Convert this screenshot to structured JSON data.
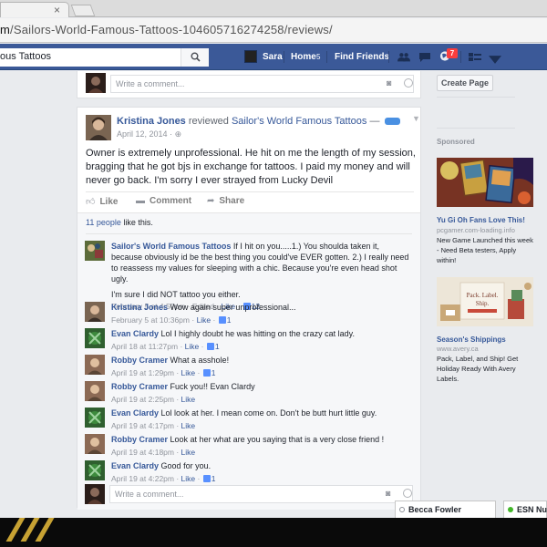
{
  "browser": {
    "url_host": "m",
    "url_path": "/Sailors-World-Famous-Tattoos-104605716274258/reviews/"
  },
  "topbar": {
    "search_value": "ous Tattoos",
    "user_name": "Sara",
    "home_label": "Home",
    "home_count": "5",
    "find_friends_label": "Find Friends",
    "notification_count": "7",
    "brand_color": "#3b5998"
  },
  "top_composer": {
    "placeholder": "Write a comment..."
  },
  "post": {
    "author": "Kristina Jones",
    "verb": "reviewed",
    "page_name": "Sailor's World Famous Tattoos",
    "dash": "—",
    "date": "April 12, 2014 ·",
    "body": "Owner is extremely unprofessional. He hit on me the length of my session, bragging that he got bjs in exchange for tattoos. I paid my money and will never go back. I'm sorry I ever strayed from Lucky Devil",
    "actions": {
      "like": "Like",
      "comment": "Comment",
      "share": "Share"
    },
    "likes_count": "11 people",
    "likes_suffix": "like this."
  },
  "comments": [
    {
      "author": "Sailor's World Famous Tattoos",
      "text": "If I hit on you.....1.) You shoulda taken it, because obviously id be the best thing you could've EVER gotten. 2.) I really need to reassess my values for sleeping with a chic. Because you're even head shot ugly.",
      "text2": "I'm sure I did NOT tattoo you either.",
      "date": "February 5 at 4:57pm",
      "edited": "Edited",
      "like": "Like",
      "likes": "12"
    },
    {
      "author": "Kristina Jones",
      "text": "Wow again super unprofessional...",
      "date": "February 5 at 10:36pm",
      "like": "Like",
      "likes": "1"
    },
    {
      "author": "Evan Clardy",
      "text": "Lol I highly doubt he was hitting on the crazy cat lady.",
      "date": "April 18 at 11:27pm",
      "like": "Like",
      "likes": "1"
    },
    {
      "author": "Robby Cramer",
      "text": "What a asshole!",
      "date": "April 19 at 1:29pm",
      "like": "Like",
      "likes": "1"
    },
    {
      "author": "Robby Cramer",
      "text": "Fuck you!! Evan Clardy",
      "date": "April 19 at 2:25pm",
      "like": "Like",
      "likes": ""
    },
    {
      "author": "Evan Clardy",
      "text": "Lol look at her. I mean come on. Don't be butt hurt little guy.",
      "date": "April 19 at 4:17pm",
      "like": "Like",
      "likes": ""
    },
    {
      "author": "Robby Cramer",
      "text": "Look at her what are you saying that is a very close friend !",
      "date": "April 19 at 4:18pm",
      "like": "Like",
      "likes": ""
    },
    {
      "author": "Evan Clardy",
      "text": "Good for you.",
      "date": "April 19 at 4:22pm",
      "like": "Like",
      "likes": "1"
    }
  ],
  "bottom_composer": {
    "placeholder": "Write a comment..."
  },
  "right": {
    "create_page": "Create Page",
    "sponsored": "Sponsored",
    "ads": [
      {
        "title": "Yu Gi Oh Fans Love This!",
        "domain": "pcgamer.com-loading.info",
        "desc": "New Game Launched this week - Need Beta testers, Apply within!"
      },
      {
        "title": "Season's Shippings",
        "domain": "www.avery.ca",
        "desc": "Pack, Label, and Ship! Get Holiday Ready With Avery Labels.",
        "img_text_1": "Pack. Label.",
        "img_text_2": "Ship."
      }
    ]
  },
  "chat": {
    "tab1": "Becca Fowler",
    "tab2": "ESN Nug"
  }
}
